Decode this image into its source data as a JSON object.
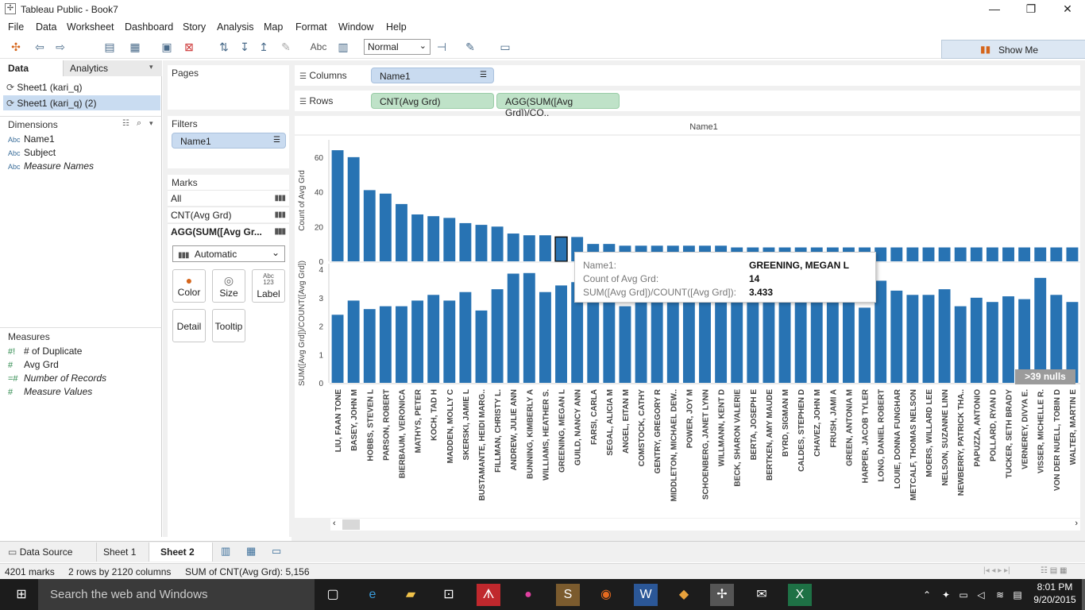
{
  "window": {
    "title": "Tableau Public - Book7"
  },
  "menu": [
    "File",
    "Data",
    "Worksheet",
    "Dashboard",
    "Story",
    "Analysis",
    "Map",
    "Format",
    "Window",
    "Help"
  ],
  "toolbar": {
    "format_select": "Normal",
    "abc_label": "Abc",
    "show_me": "Show Me"
  },
  "left": {
    "tabs": [
      "Data",
      "Analytics"
    ],
    "sources": [
      "Sheet1 (kari_q)",
      "Sheet1 (kari_q) (2)"
    ],
    "dimensions_title": "Dimensions",
    "dimensions": [
      "Name1",
      "Subject",
      "Measure Names"
    ],
    "measures_title": "Measures",
    "measures": [
      "# of Duplicate",
      "Avg Grd",
      "Number of Records",
      "Measure Values"
    ],
    "abc": "Abc"
  },
  "mid": {
    "pages_title": "Pages",
    "filters_title": "Filters",
    "filter_pill": "Name1",
    "marks_title": "Marks",
    "marks_rows": [
      "All",
      "CNT(Avg Grd)",
      "AGG(SUM([Avg Gr..."
    ],
    "mark_type": "Automatic",
    "mark_buttons": [
      "Color",
      "Size",
      "Label",
      "Detail",
      "Tooltip"
    ],
    "label_glyph": "Abc\n123"
  },
  "shelves": {
    "columns_label": "Columns",
    "columns_pill": "Name1",
    "rows_label": "Rows",
    "rows_pills": [
      "CNT(Avg Grd)",
      "AGG(SUM([Avg Grd])/CO.."
    ]
  },
  "chart_data": {
    "type": "bar",
    "header": "Name1",
    "categories": [
      "LIU, FAAN TONE",
      "BASEY, JOHN M",
      "HOBBS, STEVEN L",
      "PARSON, ROBERT",
      "BIERBAUM, VERONICA",
      "MATHYS, PETER",
      "KOCH, TAD H",
      "MADDEN, MOLLY C",
      "SKERSKI, JAMIE L",
      "BUSTAMANTE, HEIDI MARG..",
      "FILLMAN, CHRISTY L.",
      "ANDREW, JULIE ANN",
      "BUNNING, KIMBERLY A",
      "WILLIAMS, HEATHER S.",
      "GREENING, MEGAN L",
      "GUILD, NANCY ANN",
      "FARSI, CARLA",
      "SEGAL, ALICIA M",
      "ANGEL, EITAN M",
      "COMSTOCK, CATHY",
      "GENTRY, GREGORY R",
      "MIDDLETON, MICHAEL DEW..",
      "POWER, JOY M",
      "SCHOENBERG, JANET LYNN",
      "WILLMANN, KENT D",
      "BECK, SHARON VALERIE",
      "BERTA, JOSEPH E",
      "BERTKEN, AMY MAUDE",
      "BYRD, SIGMAN M",
      "CALDES, STEPHEN D",
      "CHAVEZ, JOHN M",
      "FRUSH, JAMI A",
      "GREEN, ANTONIA M",
      "HARPER, JACOB TYLER",
      "LONG, DANIEL ROBERT",
      "LOUIE, DONNA FUNGHAR",
      "METCALF, THOMAS NELSON",
      "MOERS, WILLARD LEE",
      "NELSON, SUZANNE LINN",
      "NEWBERRY, PATRICK THA..",
      "PAPUZZA, ANTONIO",
      "POLLARD, RYAN D",
      "TUCKER, SETH BRADY",
      "VERNEREY, DIVYA E.",
      "VISSER, MICHELLE R.",
      "VON DER NUELL, TOBIN D",
      "WALTER, MARTIN E"
    ],
    "series": [
      {
        "name": "Count of Avg Grd",
        "ylim": [
          0,
          70
        ],
        "ticks": [
          0,
          20,
          40,
          60
        ],
        "values": [
          64,
          60,
          41,
          39,
          33,
          27,
          26,
          25,
          22,
          21,
          20,
          16,
          15,
          15,
          14,
          14,
          10,
          10,
          9,
          9,
          9,
          9,
          9,
          9,
          9,
          8,
          8,
          8,
          8,
          8,
          8,
          8,
          8,
          8,
          8,
          8,
          8,
          8,
          8,
          8,
          8,
          8,
          8,
          8,
          8,
          8,
          8
        ]
      },
      {
        "name": "SUM([Avg Grd])/COUNT([Avg Grd])",
        "ylim": [
          0,
          4.2
        ],
        "ticks": [
          0,
          1,
          2,
          3,
          4
        ],
        "values": [
          2.4,
          2.9,
          2.6,
          2.7,
          2.7,
          2.9,
          3.1,
          2.9,
          3.2,
          2.55,
          3.3,
          3.85,
          3.87,
          3.2,
          3.433,
          3.55,
          3.0,
          3.0,
          2.7,
          2.9,
          2.9,
          3.0,
          3.0,
          2.9,
          3.0,
          2.9,
          2.9,
          2.9,
          3.0,
          2.9,
          2.9,
          3.0,
          3.0,
          2.65,
          3.6,
          3.25,
          3.1,
          3.1,
          3.3,
          2.7,
          3.0,
          2.85,
          3.05,
          2.95,
          3.7,
          3.1,
          2.85
        ]
      }
    ],
    "ylabels": [
      "Count of Avg Grd",
      "SUM([Avg Grd])/COUNT([Avg Grd])"
    ],
    "highlight_index": 14,
    "nulls_badge": ">39 nulls"
  },
  "tooltip": {
    "rows": [
      {
        "k": "Name1:",
        "v": "GREENING, MEGAN L"
      },
      {
        "k": "Count of Avg Grd:",
        "v": "14"
      },
      {
        "k": "SUM([Avg Grd])/COUNT([Avg Grd]):",
        "v": "3.433"
      }
    ]
  },
  "sheet_tabs": [
    "Data Source",
    "Sheet 1",
    "Sheet 2"
  ],
  "status": {
    "marks": "4201 marks",
    "dims": "2 rows by 2120 columns",
    "sum": "SUM of CNT(Avg Grd): 5,156"
  },
  "taskbar": {
    "search": "Search the web and Windows",
    "time": "8:01 PM",
    "date": "9/20/2015"
  },
  "colors": {
    "bar": "#2873b3",
    "accent": "#dce7f3"
  }
}
